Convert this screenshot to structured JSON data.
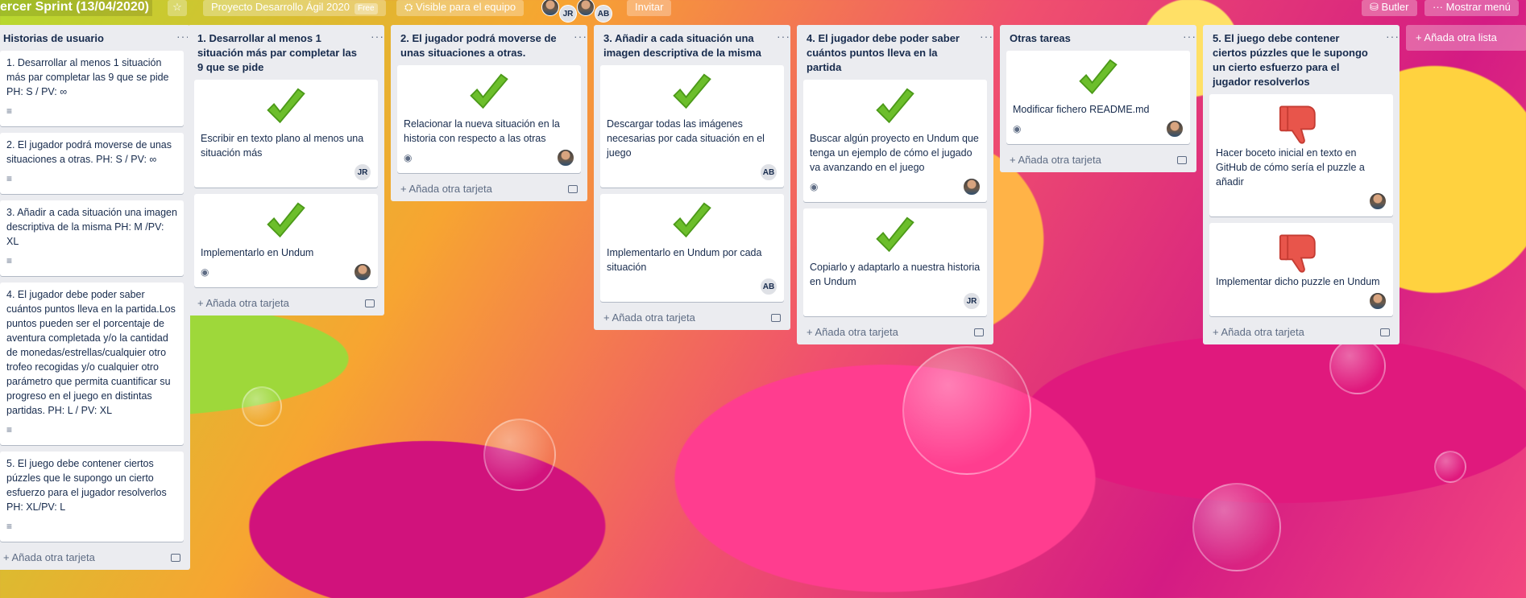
{
  "board": {
    "title": "ercer Sprint (13/04/2020)",
    "star_icon": "star-icon",
    "team_name": "Proyecto Desarrollo Ágil 2020",
    "team_badge": "Free",
    "visibility": "Visible para el equipo",
    "members": [
      "JR",
      "AB"
    ],
    "invite": "Invitar",
    "butler": "Butler",
    "menu": "Mostrar menú",
    "add_list": "+ Añada otra lista"
  },
  "add_card_label": "+ Añada otra tarjeta",
  "lists": [
    {
      "title": "Historias de usuario",
      "cards": [
        {
          "text": "1. Desarrollar al menos 1 situación más par completar las 9 que se pide PH: S / PV: ∞"
        },
        {
          "text": "2. El jugador podrá moverse de unas situaciones a otras. PH: S / PV: ∞"
        },
        {
          "text": "3. Añadir a cada situación una imagen descriptiva de la misma PH: M /PV: XL"
        },
        {
          "text": "4. El jugador debe poder saber cuántos puntos lleva en la partida.Los puntos pueden ser el porcentaje de aventura completada y/o la cantidad de monedas/estrellas/cualquier otro trofeo recogidas y/o cualquier otro parámetro que permita cuantificar su progreso en el juego en distintas partidas. PH: L / PV: XL"
        },
        {
          "text": "5. El juego debe contener ciertos púzzles que le supongo un cierto esfuerzo para el jugador resolverlos PH: XL/PV: L"
        }
      ]
    },
    {
      "title": "1. Desarrollar al menos 1 situación más par completar las 9 que se pide",
      "cards": [
        {
          "text": "Escribir en texto plano al menos una situación más",
          "member": "JR"
        },
        {
          "text": "Implementarlo en Undum",
          "watch": true,
          "member": "photo"
        }
      ]
    },
    {
      "title": "2. El jugador podrá moverse de unas situaciones a otras.",
      "cards": [
        {
          "text": "Relacionar la nueva situación en la historia con respecto a las otras",
          "watch": true,
          "member": "photo"
        }
      ]
    },
    {
      "title": "3. Añadir a cada situación una imagen descriptiva de la misma",
      "cards": [
        {
          "text": "Descargar todas las imágenes necesarias por cada situación en el juego",
          "member": "AB"
        },
        {
          "text": "Implementarlo en Undum por cada situación",
          "member": "AB"
        }
      ]
    },
    {
      "title": "4. El jugador debe poder saber cuántos puntos lleva en la partida",
      "cards": [
        {
          "text": "Buscar algún proyecto en Undum que tenga un ejemplo de cómo el jugado va avanzando en el juego",
          "watch": true,
          "member": "photo"
        },
        {
          "text": "Copiarlo y adaptarlo a nuestra historia en Undum",
          "member": "JR"
        }
      ]
    },
    {
      "title": "Otras tareas",
      "cards": [
        {
          "text": "Modificar fichero README.md",
          "watch": true,
          "member": "photo"
        }
      ]
    },
    {
      "title": "5. El juego debe contener ciertos púzzles que le supongo un cierto esfuerzo para el jugador resolverlos",
      "cards": [
        {
          "text": "Hacer boceto inicial en texto en GitHub de cómo sería el puzzle a añadir",
          "member": "photo"
        },
        {
          "text": "Implementar dicho puzzle en Undum",
          "member": "photo"
        }
      ]
    }
  ]
}
